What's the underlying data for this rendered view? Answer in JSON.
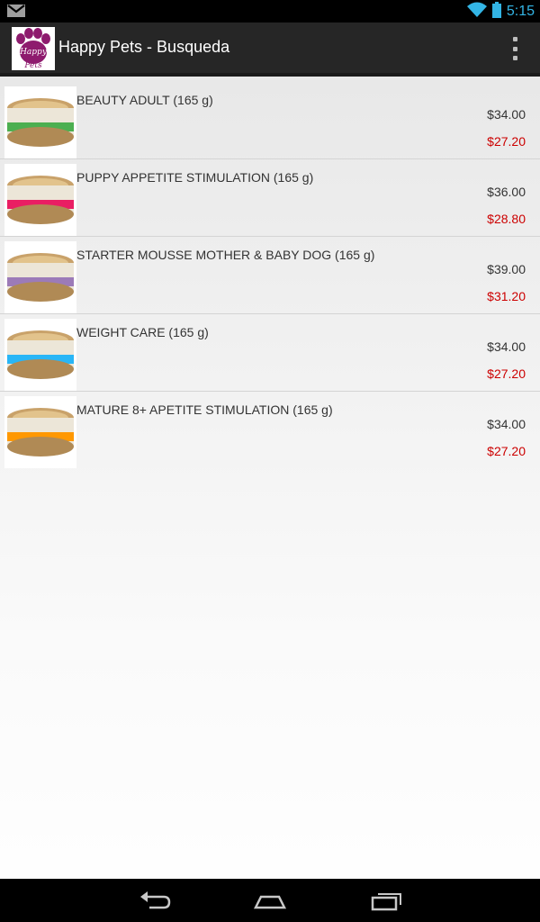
{
  "status": {
    "time": "5:15"
  },
  "app": {
    "title": "Happy Pets - Busqueda",
    "logo_text_1": "Happy",
    "logo_text_2": "Pets"
  },
  "products": [
    {
      "name": "BEAUTY ADULT (165 g)",
      "price": "$34.00",
      "sale_price": "$27.20",
      "label_color": "#4caf50"
    },
    {
      "name": "PUPPY APPETITE STIMULATION (165 g)",
      "price": "$36.00",
      "sale_price": "$28.80",
      "label_color": "#e91e63"
    },
    {
      "name": "STARTER MOUSSE MOTHER & BABY DOG (165 g)",
      "price": "$39.00",
      "sale_price": "$31.20",
      "label_color": "#9c7bb8"
    },
    {
      "name": "WEIGHT CARE (165 g)",
      "price": "$34.00",
      "sale_price": "$27.20",
      "label_color": "#29b6f6"
    },
    {
      "name": "MATURE 8+ APETITE STIMULATION (165 g)",
      "price": "$34.00",
      "sale_price": "$27.20",
      "label_color": "#ff9800"
    }
  ],
  "colors": {
    "sale": "#cc0000",
    "clock": "#33b5e5",
    "brand": "#8e1b6e"
  }
}
